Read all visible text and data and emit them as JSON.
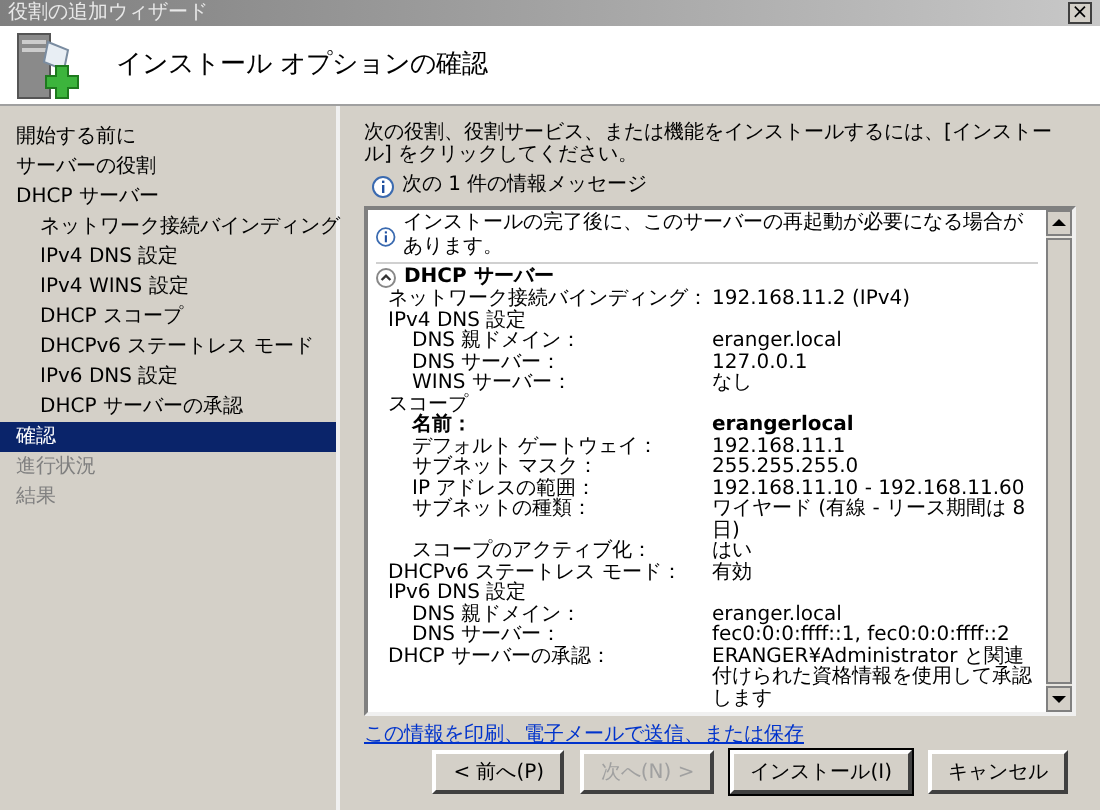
{
  "window": {
    "title": "役割の追加ウィザード",
    "close": "×"
  },
  "header": {
    "title": "インストール オプションの確認"
  },
  "nav": [
    {
      "label": "開始する前に",
      "selected": false,
      "disabled": false
    },
    {
      "label": "サーバーの役割",
      "selected": false,
      "disabled": false
    },
    {
      "label": "DHCP サーバー",
      "selected": false,
      "disabled": false,
      "children": [
        {
          "label": "ネットワーク接続バインディング",
          "selected": false,
          "disabled": false
        },
        {
          "label": "IPv4 DNS 設定",
          "selected": false,
          "disabled": false
        },
        {
          "label": "IPv4 WINS 設定",
          "selected": false,
          "disabled": false
        },
        {
          "label": "DHCP スコープ",
          "selected": false,
          "disabled": false
        },
        {
          "label": "DHCPv6 ステートレス モード",
          "selected": false,
          "disabled": false
        },
        {
          "label": "IPv6 DNS 設定",
          "selected": false,
          "disabled": false
        },
        {
          "label": "DHCP サーバーの承認",
          "selected": false,
          "disabled": false
        }
      ]
    },
    {
      "label": "確認",
      "selected": true,
      "disabled": false
    },
    {
      "label": "進行状況",
      "selected": false,
      "disabled": true
    },
    {
      "label": "結果",
      "selected": false,
      "disabled": true
    }
  ],
  "intro": "次の役割、役割サービス、または機能をインストールするには、[インストール] をクリックしてください。",
  "info_summary": "次の 1 件の情報メッセージ",
  "details": {
    "message": "インストールの完了後に、このサーバーの再起動が必要になる場合があります。",
    "section": {
      "label": "DHCP サーバー",
      "expanded": true,
      "rows": [
        {
          "label": "ネットワーク接続バインディング：",
          "value": "192.168.11.2 (IPv4)",
          "bold": false
        },
        {
          "label": "IPv4 DNS 設定",
          "bold": false,
          "children": [
            {
              "label": "DNS 親ドメイン：",
              "value": "eranger.local",
              "bold": false
            },
            {
              "label": "DNS サーバー：",
              "value": "127.0.0.1",
              "bold": false
            },
            {
              "label": "WINS サーバー：",
              "value": "なし",
              "bold": false
            }
          ]
        },
        {
          "label": "スコープ",
          "bold": false,
          "children": [
            {
              "label": "名前：",
              "value": "erangerlocal",
              "bold": true
            },
            {
              "label": "デフォルト ゲートウェイ：",
              "value": "192.168.11.1",
              "bold": false
            },
            {
              "label": "サブネット マスク：",
              "value": "255.255.255.0",
              "bold": false
            },
            {
              "label": "IP アドレスの範囲：",
              "value": "192.168.11.10 - 192.168.11.60",
              "bold": false
            },
            {
              "label": "サブネットの種類：",
              "value": "ワイヤード (有線 - リース期間は 8 日)",
              "bold": false
            },
            {
              "label": "スコープのアクティブ化：",
              "value": "はい",
              "bold": false
            }
          ]
        },
        {
          "label": "DHCPv6 ステートレス モード：",
          "value": "有効",
          "bold": false
        },
        {
          "label": "IPv6 DNS 設定",
          "bold": false,
          "children": [
            {
              "label": "DNS 親ドメイン：",
              "value": "eranger.local",
              "bold": false
            },
            {
              "label": "DNS サーバー：",
              "value": "fec0:0:0:ffff::1, fec0:0:0:ffff::2",
              "bold": false
            }
          ]
        },
        {
          "label": "DHCP サーバーの承認：",
          "value": "ERANGER¥Administrator と関連付けられた資格情報を使用して承認します",
          "bold": false
        }
      ]
    }
  },
  "link": "この情報を印刷、電子メールで送信、または保存",
  "buttons": [
    {
      "label": "< 前へ(P)",
      "disabled": false,
      "default": false
    },
    {
      "label": "次へ(N) >",
      "disabled": true,
      "default": false
    },
    {
      "label": "インストール(I)",
      "disabled": false,
      "default": true
    },
    {
      "label": "キャンセル",
      "disabled": false,
      "default": false
    }
  ]
}
